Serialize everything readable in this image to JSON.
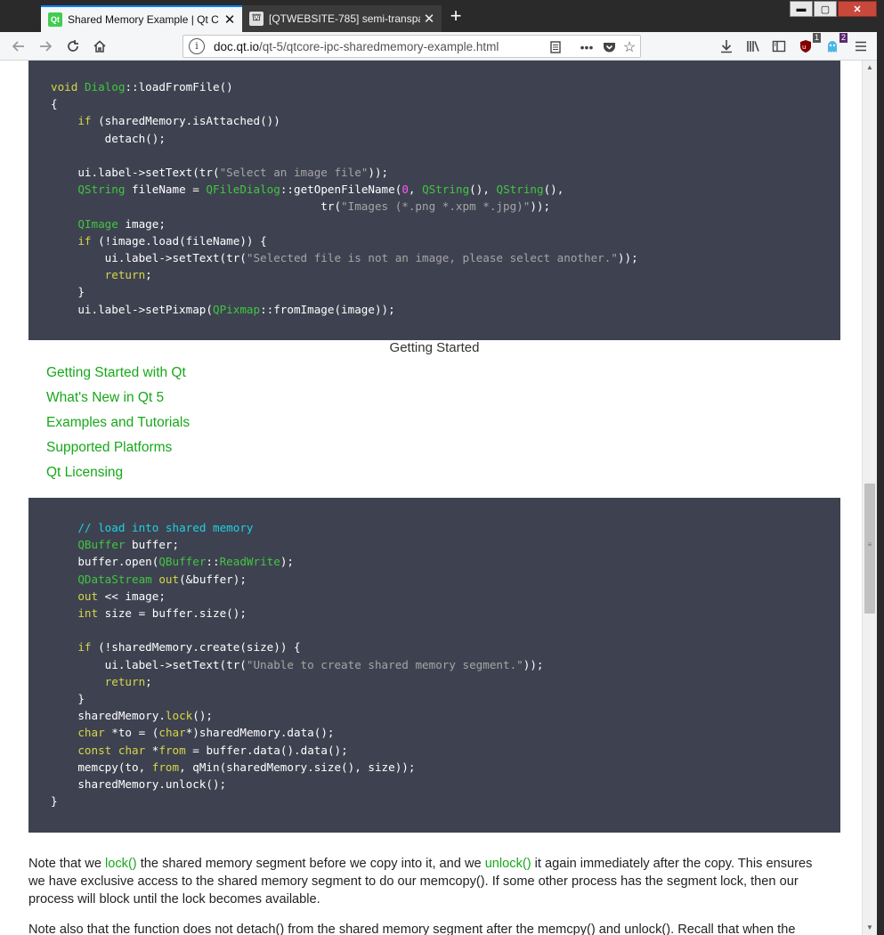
{
  "browser": {
    "tabs": [
      {
        "favicon": "Qt",
        "label": "Shared Memory Example | Qt C",
        "active": true
      },
      {
        "favicon": "⛫",
        "label": "[QTWEBSITE-785] semi-transpa",
        "active": false
      }
    ],
    "new_tab": "+",
    "window_controls": {
      "minimize": "▬",
      "maximize": "▢",
      "close": "✕"
    },
    "url": {
      "domain": "doc.qt.io",
      "path": "/qt-5/qtcore-ipc-sharedmemory-example.html"
    },
    "toolbar_icons": [
      "reader-view-icon",
      "page-actions-icon",
      "pocket-icon",
      "bookmark-star-icon",
      "download-icon",
      "library-icon",
      "sidebar-icon",
      "ublock-icon",
      "ghostery-icon",
      "menu-icon"
    ],
    "badges": {
      "ublock": "1",
      "ghostery": "2"
    },
    "accent_color": "#0a84ff"
  },
  "page": {
    "getting_started": {
      "title": "Getting Started",
      "links": [
        "Getting Started with Qt",
        "What's New in Qt 5",
        "Examples and Tutorials",
        "Supported Platforms",
        "Qt Licensing"
      ]
    },
    "note": {
      "t1": "Note that we ",
      "link_lock": "lock()",
      "t2": " the shared memory segment before we copy into it, and we ",
      "link_unlock": "unlock()",
      "t3": " it again immediately after the copy. This ensures we have exclusive access to the shared memory segment to do our memcopy(). If some other process has the segment lock, then our process will block until the lock becomes available."
    },
    "note_next": {
      "t1": "Note also that the function does not detach() from the shared memory segment after the memcpy() and unlock(). Recall that when the",
      "link": "detach()"
    },
    "colors": {
      "link": "#17a81a",
      "code_bg": "#3e4250",
      "keyword": "#d6d649",
      "type": "#40c640",
      "string": "#a5a5a5",
      "comment": "#1ed0e0"
    }
  },
  "code_blocks": [
    {
      "lines": [
        [
          [
            "kw",
            "void"
          ],
          [
            "t",
            " "
          ],
          [
            "ty",
            "Dialog"
          ],
          [
            "t",
            "::loadFromFile()"
          ]
        ],
        [
          [
            "t",
            "{"
          ]
        ],
        [
          [
            "t",
            "    "
          ],
          [
            "kw",
            "if"
          ],
          [
            "t",
            " (sharedMemory.isAttached())"
          ]
        ],
        [
          [
            "t",
            "        detach();"
          ]
        ],
        [
          [
            "t",
            ""
          ]
        ],
        [
          [
            "t",
            "    ui.label->setText(tr("
          ],
          [
            "st",
            "\"Select an image file\""
          ],
          [
            "t",
            "));"
          ]
        ],
        [
          [
            "t",
            "    "
          ],
          [
            "ty",
            "QString"
          ],
          [
            "t",
            " fileName = "
          ],
          [
            "ty",
            "QFileDialog"
          ],
          [
            "t",
            "::getOpenFileName("
          ],
          [
            "nm",
            "0"
          ],
          [
            "t",
            ", "
          ],
          [
            "ty",
            "QString"
          ],
          [
            "t",
            "(), "
          ],
          [
            "ty",
            "QString"
          ],
          [
            "t",
            "(),"
          ]
        ],
        [
          [
            "t",
            "                                        tr("
          ],
          [
            "st",
            "\"Images (*.png *.xpm *.jpg)\""
          ],
          [
            "t",
            "));"
          ]
        ],
        [
          [
            "t",
            "    "
          ],
          [
            "ty",
            "QImage"
          ],
          [
            "t",
            " image;"
          ]
        ],
        [
          [
            "t",
            "    "
          ],
          [
            "kw",
            "if"
          ],
          [
            "t",
            " (!image.load(fileName)) {"
          ]
        ],
        [
          [
            "t",
            "        ui.label->setText(tr("
          ],
          [
            "st",
            "\"Selected file is not an image, please select another.\""
          ],
          [
            "t",
            "));"
          ]
        ],
        [
          [
            "t",
            "        "
          ],
          [
            "kw",
            "return"
          ],
          [
            "t",
            ";"
          ]
        ],
        [
          [
            "t",
            "    }"
          ]
        ],
        [
          [
            "t",
            "    ui.label->setPixmap("
          ],
          [
            "ty",
            "QPixmap"
          ],
          [
            "t",
            "::fromImage(image));"
          ]
        ]
      ]
    },
    {
      "lines": [
        [
          [
            "t",
            "    "
          ],
          [
            "cm",
            "// load into shared memory"
          ]
        ],
        [
          [
            "t",
            "    "
          ],
          [
            "ty",
            "QBuffer"
          ],
          [
            "t",
            " buffer;"
          ]
        ],
        [
          [
            "t",
            "    buffer.open("
          ],
          [
            "ty",
            "QBuffer"
          ],
          [
            "t",
            "::"
          ],
          [
            "ty",
            "ReadWrite"
          ],
          [
            "t",
            ");"
          ]
        ],
        [
          [
            "t",
            "    "
          ],
          [
            "ty",
            "QDataStream"
          ],
          [
            "t",
            " "
          ],
          [
            "kw",
            "out"
          ],
          [
            "t",
            "(&buffer);"
          ]
        ],
        [
          [
            "t",
            "    "
          ],
          [
            "kw",
            "out"
          ],
          [
            "t",
            " << image;"
          ]
        ],
        [
          [
            "t",
            "    "
          ],
          [
            "kw",
            "int"
          ],
          [
            "t",
            " size = buffer.size();"
          ]
        ],
        [
          [
            "t",
            ""
          ]
        ],
        [
          [
            "t",
            "    "
          ],
          [
            "kw",
            "if"
          ],
          [
            "t",
            " (!sharedMemory.create(size)) {"
          ]
        ],
        [
          [
            "t",
            "        ui.label->setText(tr("
          ],
          [
            "st",
            "\"Unable to create shared memory segment.\""
          ],
          [
            "t",
            "));"
          ]
        ],
        [
          [
            "t",
            "        "
          ],
          [
            "kw",
            "return"
          ],
          [
            "t",
            ";"
          ]
        ],
        [
          [
            "t",
            "    }"
          ]
        ],
        [
          [
            "t",
            "    sharedMemory."
          ],
          [
            "kw",
            "lock"
          ],
          [
            "t",
            "();"
          ]
        ],
        [
          [
            "t",
            "    "
          ],
          [
            "kw",
            "char"
          ],
          [
            "t",
            " *to = ("
          ],
          [
            "kw",
            "char"
          ],
          [
            "t",
            "*)sharedMemory.data();"
          ]
        ],
        [
          [
            "t",
            "    "
          ],
          [
            "kw",
            "const"
          ],
          [
            "t",
            " "
          ],
          [
            "kw",
            "char"
          ],
          [
            "t",
            " *"
          ],
          [
            "kw",
            "from"
          ],
          [
            "t",
            " = buffer.data().data();"
          ]
        ],
        [
          [
            "t",
            "    memcpy(to, "
          ],
          [
            "kw",
            "from"
          ],
          [
            "t",
            ", qMin(sharedMemory.size(), size));"
          ]
        ],
        [
          [
            "t",
            "    sharedMemory.unlock();"
          ]
        ],
        [
          [
            "t",
            "}"
          ]
        ]
      ]
    }
  ]
}
